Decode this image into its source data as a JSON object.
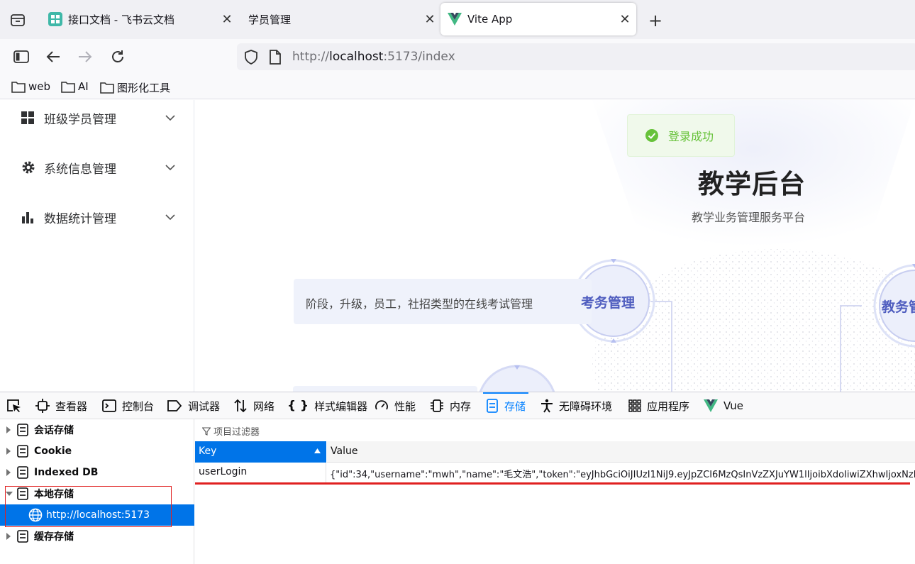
{
  "tabs": [
    {
      "title": "接口文档 - 飞书云文档",
      "icon": "feishu-icon"
    },
    {
      "title": "学员管理",
      "icon": ""
    },
    {
      "title": "Vite App",
      "icon": "vue-logo-icon",
      "active": true
    }
  ],
  "nav": {
    "url_prefix": "http://",
    "url_host": "localhost",
    "url_rest": ":5173/index"
  },
  "bookmarks": [
    "web",
    "AI",
    "图形化工具"
  ],
  "sidebar": {
    "items": [
      {
        "label": "班级学员管理",
        "icon": "grid-icon"
      },
      {
        "label": "系统信息管理",
        "icon": "gear-icon"
      },
      {
        "label": "数据统计管理",
        "icon": "bar-chart-icon"
      }
    ]
  },
  "main": {
    "toast": "登录成功",
    "title": "教学后台",
    "subtitle": "教学业务管理服务平台",
    "exam_desc": "阶段，升级，员工，社招类型的在线考试管理",
    "exam_label": "考务管理",
    "teach_label": "教务管"
  },
  "devtools": {
    "tabs": [
      {
        "label": "查看器",
        "icon": "inspector-icon"
      },
      {
        "label": "控制台",
        "icon": "console-icon"
      },
      {
        "label": "调试器",
        "icon": "debugger-icon"
      },
      {
        "label": "网络",
        "icon": "network-icon"
      },
      {
        "label": "样式编辑器",
        "icon": "style-editor-icon"
      },
      {
        "label": "性能",
        "icon": "performance-icon"
      },
      {
        "label": "内存",
        "icon": "memory-icon"
      },
      {
        "label": "存储",
        "icon": "storage-icon",
        "active": true
      },
      {
        "label": "无障碍环境",
        "icon": "accessibility-icon"
      },
      {
        "label": "应用程序",
        "icon": "application-icon"
      },
      {
        "label": "Vue",
        "icon": "vue-logo-icon"
      }
    ],
    "tree": [
      {
        "label": "会话存储",
        "expanded": false
      },
      {
        "label": "Cookie",
        "expanded": false
      },
      {
        "label": "Indexed DB",
        "expanded": false
      },
      {
        "label": "本地存储",
        "expanded": true
      },
      {
        "label": "http://localhost:5173",
        "child": true,
        "selected": true
      },
      {
        "label": "缓存存储",
        "expanded": false
      }
    ],
    "filter_placeholder": "项目过滤器",
    "columns": {
      "key": "Key",
      "value": "Value"
    },
    "row": {
      "key": "userLogin",
      "value": "{\"id\":34,\"username\":\"mwh\",\"name\":\"毛文浩\",\"token\":\"eyJhbGciOiJIUzI1NiJ9.eyJpZCI6MzQsInVzZXJuYW1lIjoibXdoIiwiZXhwIjoxNzE"
    }
  },
  "colors": {
    "accent": "#0074e8",
    "success": "#67c23a",
    "highlight_box": "#e02020",
    "underline": "#e02020"
  }
}
